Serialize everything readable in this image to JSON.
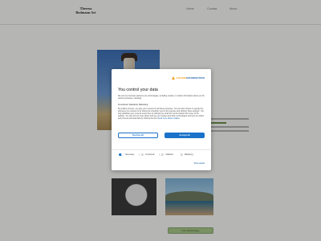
{
  "site": {
    "brand": "Theresa Bodmann Art",
    "nav": [
      {
        "label": "Home"
      },
      {
        "label": "Contact"
      },
      {
        "label": "About"
      }
    ],
    "footer_button": "Cues Werkstrategy"
  },
  "cookie_dialog": {
    "logo": {
      "part1": "COOKIE",
      "part2": "INFORMATION"
    },
    "title": "You control your data",
    "intro": "We and our business partners use technologies, including cookies, to collect information about you for various purposes, including:",
    "purposes": "Functional, Statistical, Marketing",
    "details": "By clicking 'Accept', you give your consent for all these purposes. You can also choose to specify the purposes you consent to by ticking the checkbox next to the purpose and clicking 'Save settings'. You may withdraw your consent at any time by clicking the small icon at the bottom left corner of the website. You can find out more about how we use cookies and other technologies and how we collect and process personal data by clicking the link.",
    "more_link": "Read more about cookies",
    "decline_label": "Decline all",
    "accept_label": "Accept all",
    "toggles": [
      {
        "label": "Necessary",
        "on": true
      },
      {
        "label": "Functional",
        "on": false
      },
      {
        "label": "Statistics",
        "on": false
      },
      {
        "label": "Marketing",
        "on": false
      }
    ],
    "show_details": "Show details"
  },
  "colors": {
    "accent": "#1a73c9",
    "logo_orange": "#f4a01f",
    "logo_blue": "#1f5fa8"
  }
}
